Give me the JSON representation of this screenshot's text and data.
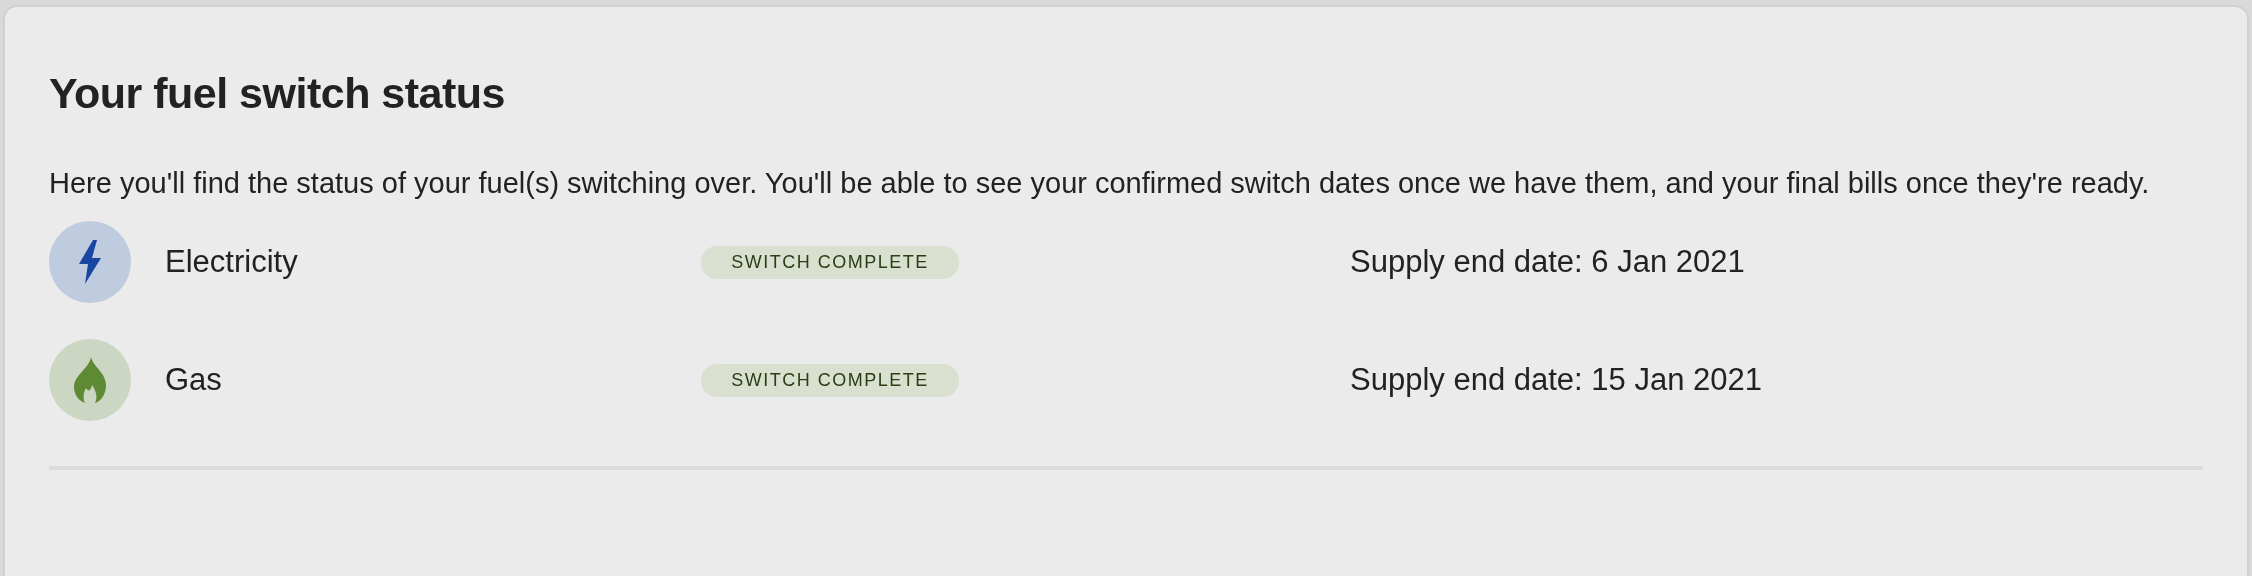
{
  "title": "Your fuel switch status",
  "intro": "Here you'll find the status of your fuel(s) switching over. You'll be able to see your confirmed switch dates once we have them, and your final bills once they're ready.",
  "fuels": [
    {
      "kind": "electricity",
      "name": "Electricity",
      "status": "SWITCH COMPLETE",
      "end_date": "Supply end date: 6 Jan 2021"
    },
    {
      "kind": "gas",
      "name": "Gas",
      "status": "SWITCH COMPLETE",
      "end_date": "Supply end date: 15 Jan 2021"
    }
  ]
}
